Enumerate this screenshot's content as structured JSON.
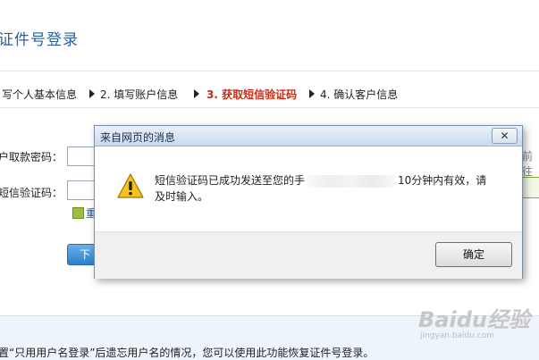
{
  "page": {
    "title": "证件号登录",
    "steps": [
      {
        "label": "写个人基本信息"
      },
      {
        "label": "2. 填写账户信息"
      },
      {
        "label": "3. 获取短信验证码"
      },
      {
        "label": "4. 确认客户信息"
      }
    ],
    "form": {
      "password_label": "户取款密码：",
      "sms_label": "短信验证码：",
      "resend_link": "重",
      "next_button": "下",
      "right_peek": "前往"
    },
    "footer_note": "置“只用用户名登录”后遗忘用户名的情况，您可以使用此功能恢复证件号登录。"
  },
  "dialog": {
    "title": "来自网页的消息",
    "close_symbol": "✕",
    "message_part1": "短信验证码已成功发送至您的手",
    "message_part2": "10分钟内有效，请及时输入。",
    "ok_button": "确定",
    "icon": "warning-icon"
  },
  "watermark": {
    "main": "Baidu经验",
    "sub": "jingyan.baidu.com"
  }
}
